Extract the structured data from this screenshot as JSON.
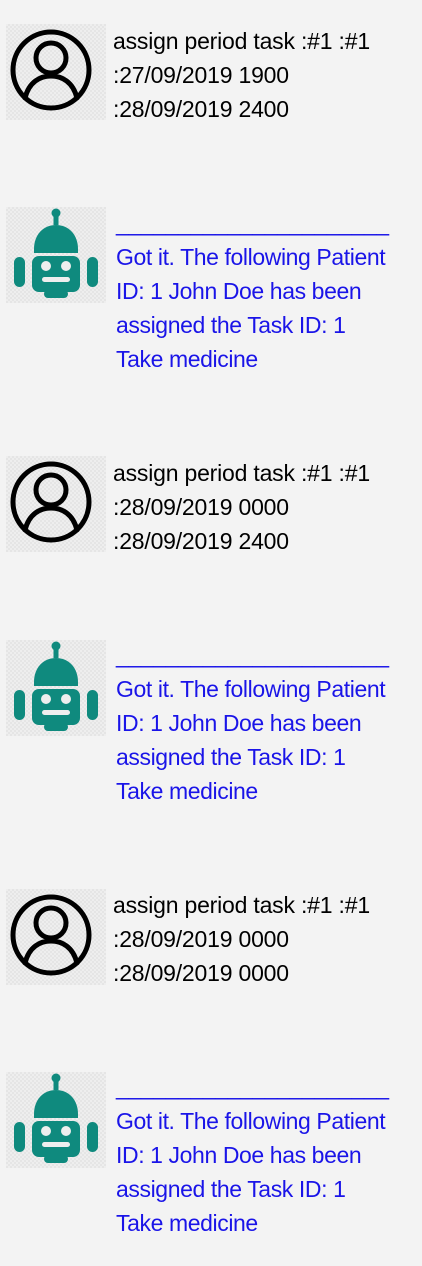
{
  "colors": {
    "background": "#f3f3f3",
    "user_text": "#000000",
    "bot_text": "#1a14e8",
    "bot_icon": "#0f8a7e",
    "user_icon": "#000000"
  },
  "messages": [
    {
      "sender": "user",
      "icon": "user-profile-icon",
      "lines": [
        "assign period task :#1 :#1",
        ":27/09/2019 1900",
        ":28/09/2019 2400"
      ]
    },
    {
      "sender": "bot",
      "icon": "robot-icon",
      "divider": "______________________",
      "lines": [
        "Got it. The following Patient",
        "ID: 1 John Doe has been",
        "assigned the Task ID: 1",
        "Take medicine"
      ]
    },
    {
      "sender": "user",
      "icon": "user-profile-icon",
      "lines": [
        "assign period task :#1 :#1",
        ":28/09/2019 0000",
        ":28/09/2019 2400"
      ]
    },
    {
      "sender": "bot",
      "icon": "robot-icon",
      "divider": "______________________",
      "lines": [
        "Got it. The following Patient",
        "ID: 1 John Doe has been",
        "assigned the Task ID: 1",
        "Take medicine"
      ]
    },
    {
      "sender": "user",
      "icon": "user-profile-icon",
      "lines": [
        "assign period task :#1 :#1",
        ":28/09/2019 0000",
        ":28/09/2019 0000"
      ]
    },
    {
      "sender": "bot",
      "icon": "robot-icon",
      "divider": "______________________",
      "lines": [
        "Got it. The following Patient",
        "ID: 1 John Doe has been",
        "assigned the Task ID: 1",
        "Take medicine"
      ]
    }
  ]
}
